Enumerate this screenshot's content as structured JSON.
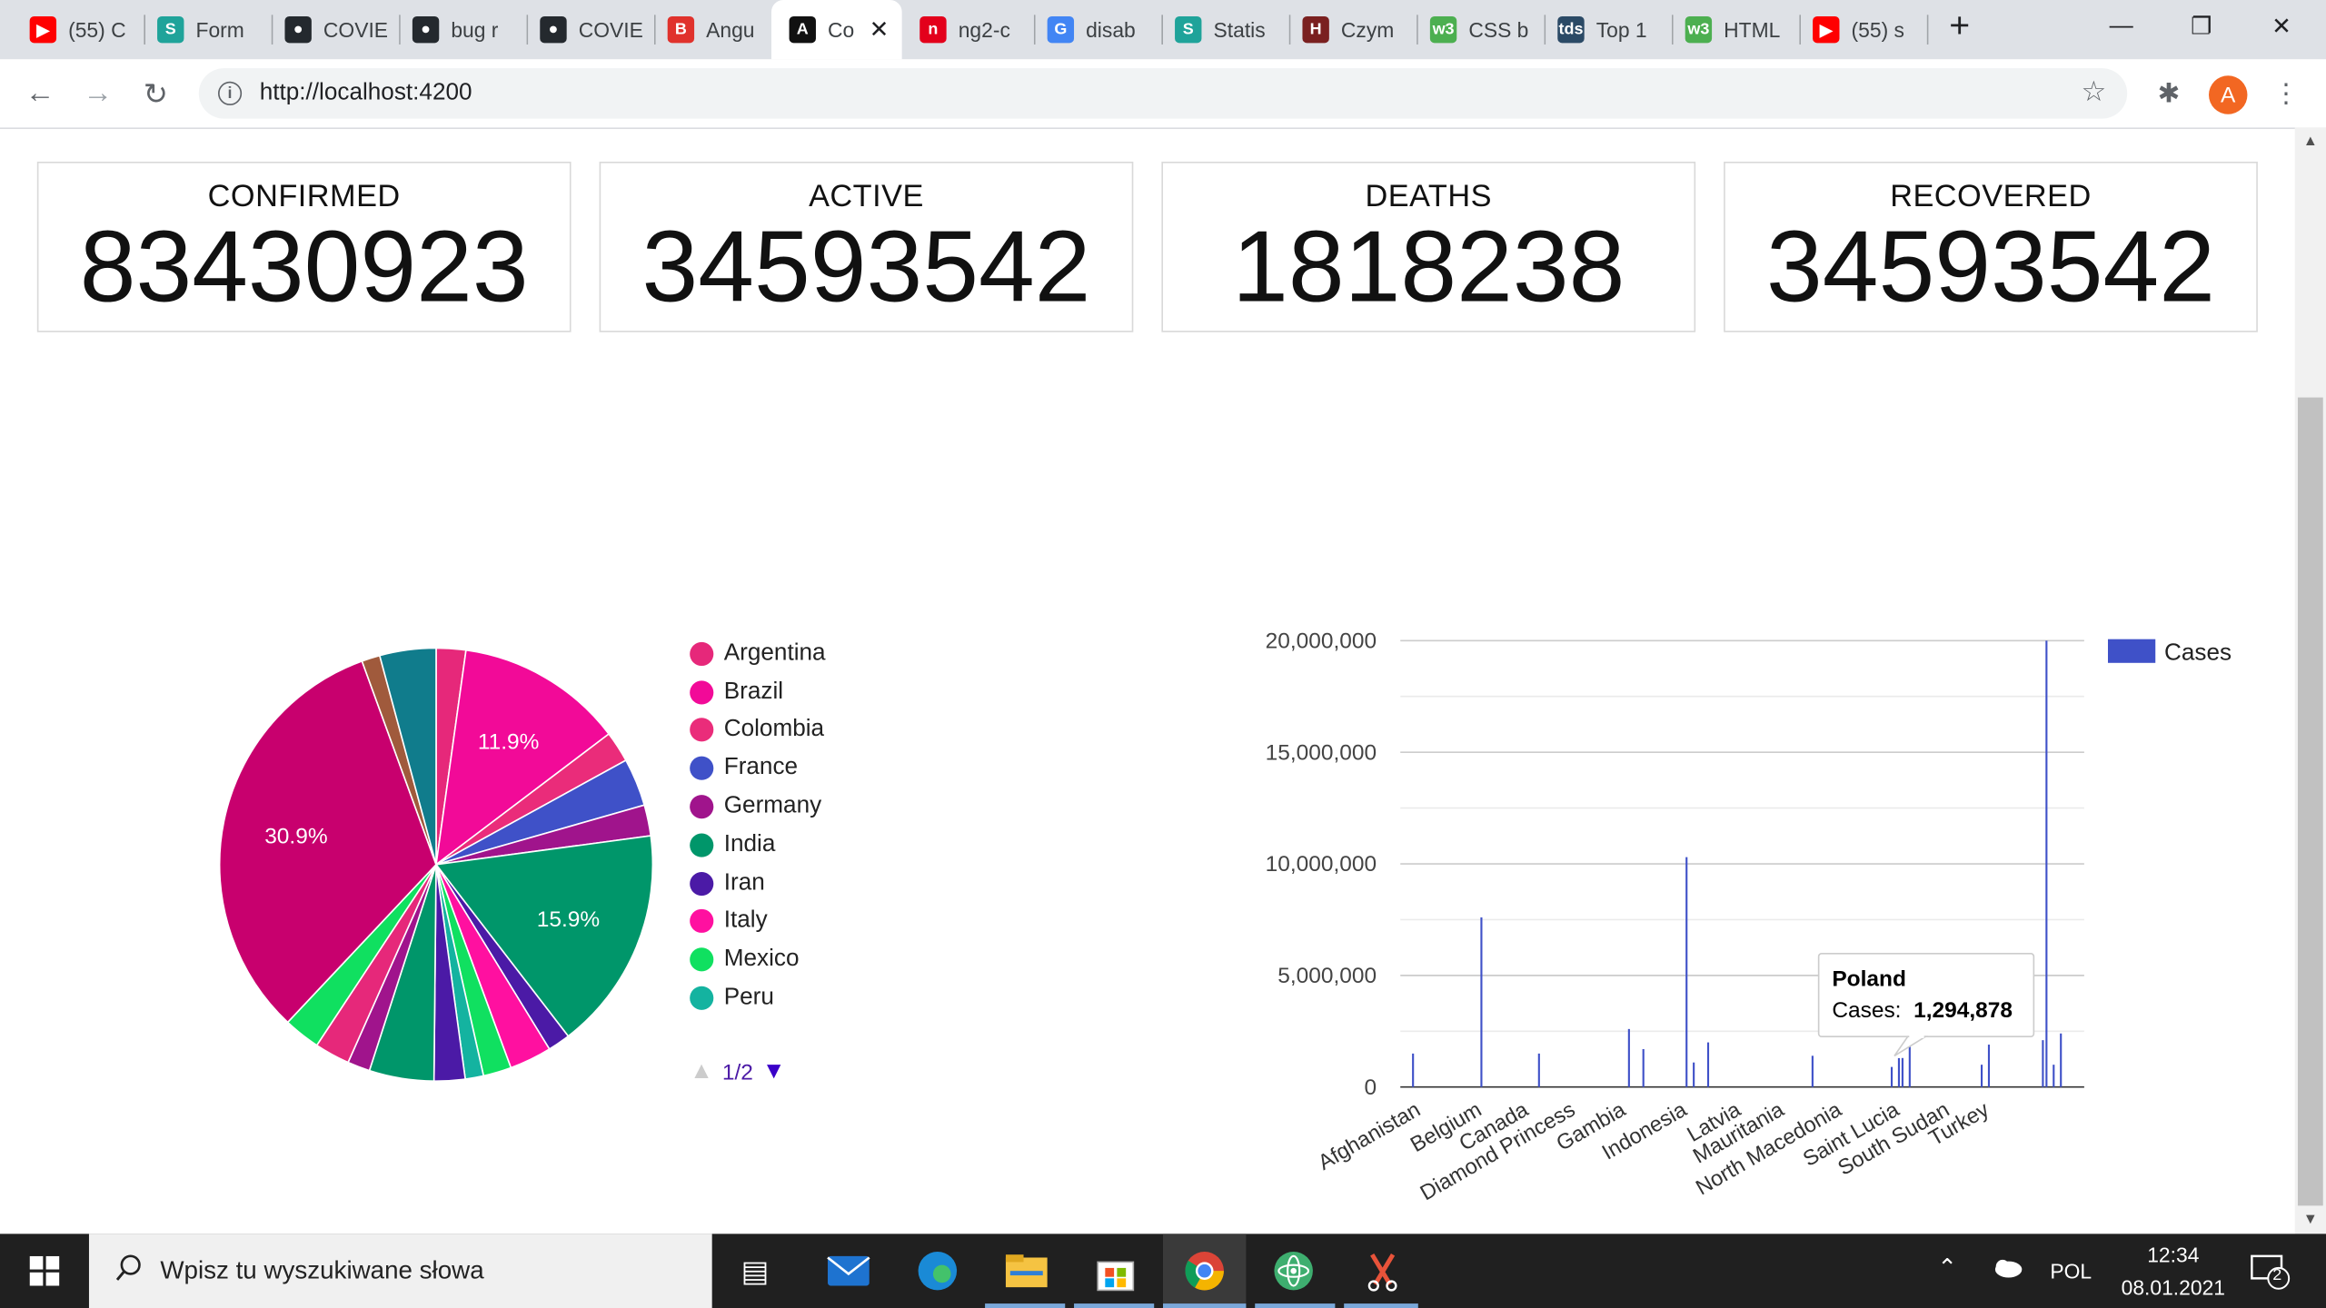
{
  "browser": {
    "tabs": [
      {
        "label": "(55) C",
        "icon": "youtube-icon",
        "color": "#ff0000"
      },
      {
        "label": "Form",
        "icon": "s-icon",
        "color": "#1fa39a"
      },
      {
        "label": "COVIE",
        "icon": "github-icon",
        "color": "#24292e"
      },
      {
        "label": "bug r",
        "icon": "github-icon",
        "color": "#24292e"
      },
      {
        "label": "COVIE",
        "icon": "github-icon",
        "color": "#24292e"
      },
      {
        "label": "Angu",
        "icon": "brave-icon",
        "color": "#e0322c"
      },
      {
        "label": "Co",
        "icon": "angular-icon",
        "color": "#111111",
        "active": true
      },
      {
        "label": "ng2-c",
        "icon": "n-icon",
        "color": "#e3001b"
      },
      {
        "label": "disab",
        "icon": "google-icon",
        "color": "#4285f4"
      },
      {
        "label": "Statis",
        "icon": "s-icon",
        "color": "#1fa39a"
      },
      {
        "label": "Czym",
        "icon": "czym-icon",
        "color": "#7a2020"
      },
      {
        "label": "CSS b",
        "icon": "w3-icon",
        "color": "#4caf50"
      },
      {
        "label": "Top 1",
        "icon": "tds-icon",
        "color": "#2b4a66"
      },
      {
        "label": "HTML",
        "icon": "w3-icon",
        "color": "#4caf50"
      },
      {
        "label": "(55) s",
        "icon": "youtube-icon",
        "color": "#ff0000"
      }
    ],
    "new_tab": "+",
    "url": "http://localhost:4200",
    "avatar_letter": "A"
  },
  "stats": [
    {
      "title": "CONFIRMED",
      "value": "83430923"
    },
    {
      "title": "ACTIVE",
      "value": "34593542"
    },
    {
      "title": "DEATHS",
      "value": "1818238"
    },
    {
      "title": "RECOVERED",
      "value": "34593542"
    }
  ],
  "pie_legend": {
    "items": [
      {
        "label": "Argentina",
        "color": "#e6287a"
      },
      {
        "label": "Brazil",
        "color": "#f20a98"
      },
      {
        "label": "Colombia",
        "color": "#ea2c7a"
      },
      {
        "label": "France",
        "color": "#3f51c8"
      },
      {
        "label": "Germany",
        "color": "#a0148c"
      },
      {
        "label": "India",
        "color": "#00966a"
      },
      {
        "label": "Iran",
        "color": "#4b1aa6"
      },
      {
        "label": "Italy",
        "color": "#ff10a0"
      },
      {
        "label": "Mexico",
        "color": "#10e060"
      },
      {
        "label": "Peru",
        "color": "#14b3a0"
      }
    ],
    "page": "1/2"
  },
  "chart_data": [
    {
      "type": "pie",
      "slice_labels": [
        "11.9%",
        "15.9%",
        "30.9%"
      ],
      "slices": [
        {
          "label": "Argentina",
          "value": 2.1,
          "color": "#e6287a"
        },
        {
          "label": "Brazil",
          "value": 11.9,
          "color": "#f20a98"
        },
        {
          "label": "Colombia",
          "value": 2.2,
          "color": "#ea2c7a"
        },
        {
          "label": "France",
          "value": 3.4,
          "color": "#3f51c8"
        },
        {
          "label": "Germany",
          "value": 2.2,
          "color": "#a0148c"
        },
        {
          "label": "India",
          "value": 15.9,
          "color": "#00966a"
        },
        {
          "label": "Iran",
          "value": 1.6,
          "color": "#4b1aa6"
        },
        {
          "label": "Italy",
          "value": 3.0,
          "color": "#ff10a0"
        },
        {
          "label": "Mexico",
          "value": 2.0,
          "color": "#10e060"
        },
        {
          "label": "Peru",
          "value": 1.3,
          "color": "#14b3a0"
        },
        {
          "label": "",
          "value": 2.2,
          "color": "#4b1aa6"
        },
        {
          "label": "",
          "value": 4.6,
          "color": "#00966a"
        },
        {
          "label": "",
          "value": 1.6,
          "color": "#a0148c"
        },
        {
          "label": "",
          "value": 2.5,
          "color": "#e6287a"
        },
        {
          "label": "",
          "value": 2.6,
          "color": "#10e060"
        },
        {
          "label": "",
          "value": 30.9,
          "color": "#c8006e"
        },
        {
          "label": "",
          "value": 1.3,
          "color": "#a05a3c"
        },
        {
          "label": "",
          "value": 4.0,
          "color": "#107c8c"
        }
      ]
    },
    {
      "type": "bar",
      "series_name": "Cases",
      "color": "#3f51c8",
      "ylim": [
        0,
        20000000
      ],
      "yticks": [
        "0",
        "5,000,000",
        "10,000,000",
        "15,000,000",
        "20,000,000"
      ],
      "ytick_values": [
        0,
        5000000,
        10000000,
        15000000,
        20000000
      ],
      "xtick_labels": [
        "Afghanistan",
        "Belgium",
        "Canada",
        "Diamond Princess",
        "Gambia",
        "Indonesia",
        "Latvia",
        "Mauritania",
        "North Macedonia",
        "Saint Lucia",
        "South Sudan",
        "Turkey"
      ],
      "xtick_positions": [
        3,
        20,
        33,
        46,
        60,
        77,
        92,
        104,
        120,
        136,
        150,
        161
      ],
      "category_count": 190,
      "bars": [
        {
          "i": 3,
          "v": 1500000
        },
        {
          "i": 22,
          "v": 7600000
        },
        {
          "i": 38,
          "v": 1500000
        },
        {
          "i": 63,
          "v": 2600000
        },
        {
          "i": 67,
          "v": 1700000
        },
        {
          "i": 79,
          "v": 10300000
        },
        {
          "i": 81,
          "v": 1100000
        },
        {
          "i": 85,
          "v": 2000000
        },
        {
          "i": 114,
          "v": 1400000
        },
        {
          "i": 136,
          "v": 900000
        },
        {
          "i": 138,
          "v": 1294878
        },
        {
          "i": 139,
          "v": 1300000
        },
        {
          "i": 141,
          "v": 1800000
        },
        {
          "i": 161,
          "v": 1000000
        },
        {
          "i": 163,
          "v": 1900000
        },
        {
          "i": 178,
          "v": 2100000
        },
        {
          "i": 179,
          "v": 20000000
        },
        {
          "i": 181,
          "v": 1000000
        },
        {
          "i": 183,
          "v": 2400000
        }
      ],
      "tooltip": {
        "title": "Poland",
        "label": "Cases:",
        "value": "1,294,878",
        "bar_index": 138
      }
    }
  ],
  "taskbar": {
    "search_placeholder": "Wpisz tu wyszukiwane słowa",
    "lang": "POL",
    "time": "12:34",
    "date": "08.01.2021",
    "notifications": "2"
  }
}
